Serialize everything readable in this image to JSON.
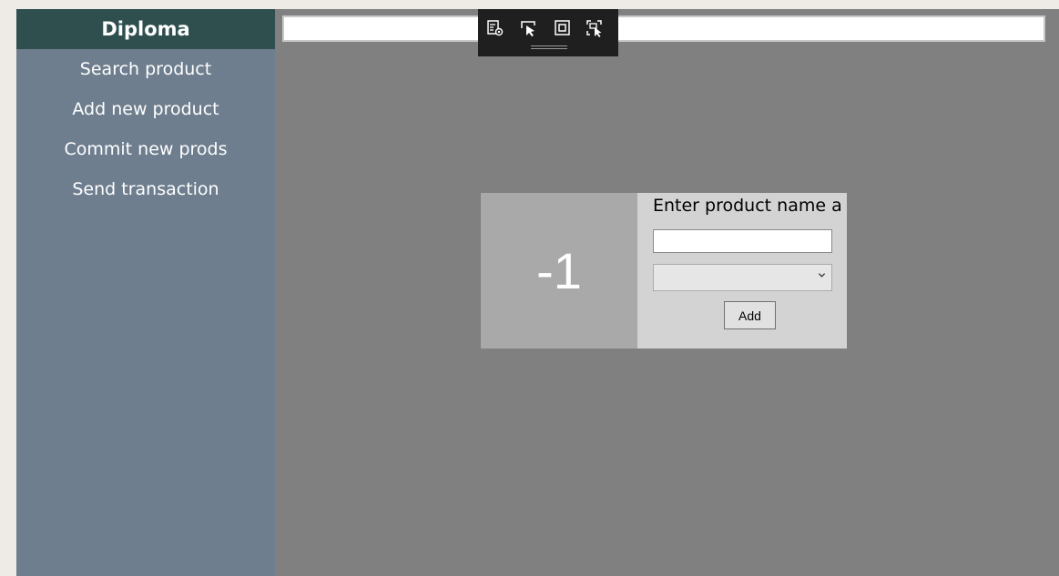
{
  "sidebar": {
    "title": "Diploma",
    "items": [
      {
        "label": "Search product"
      },
      {
        "label": "Add new product"
      },
      {
        "label": "Commit new prods"
      },
      {
        "label": "Send transaction"
      }
    ]
  },
  "search": {
    "value": ""
  },
  "toolbar": {
    "icons": [
      "live-visual-tree-icon",
      "select-element-icon",
      "display-layout-adorners-icon",
      "track-focus-icon"
    ]
  },
  "card": {
    "counter": "-1",
    "form_title": "Enter product name a",
    "name_value": "",
    "type_selected": "",
    "add_label": "Add"
  },
  "colors": {
    "sidebar_header": "#2f4f4f",
    "sidebar_bg": "#6e7e8e",
    "main_bg": "#808080",
    "counter_bg": "#a9a9a9",
    "form_bg": "#d3d3d3"
  }
}
